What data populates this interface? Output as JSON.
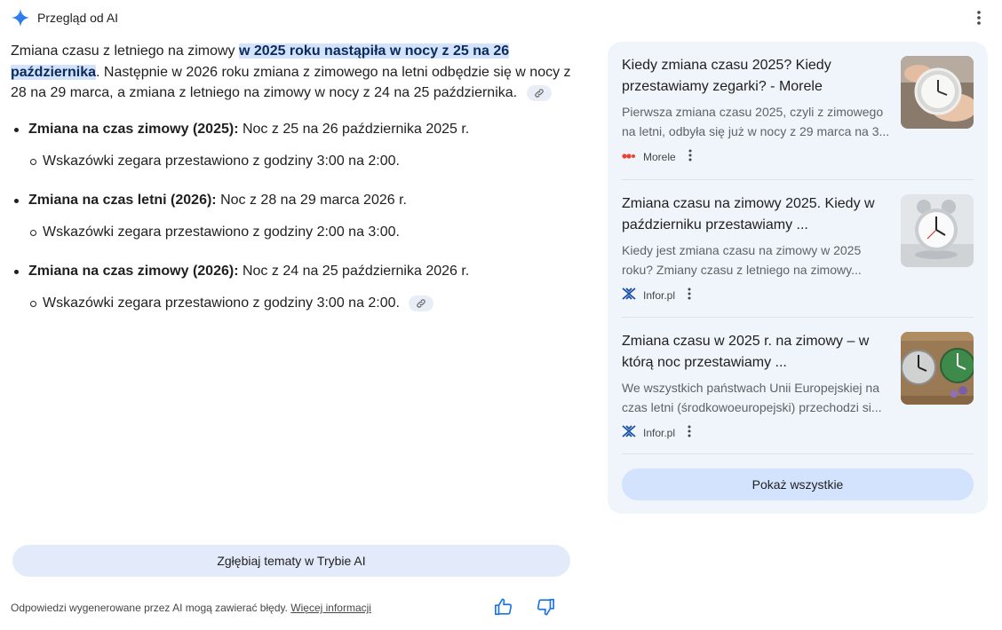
{
  "header": {
    "title": "Przegląd od AI",
    "icon": "sparkle-icon",
    "accent": "#4285f4"
  },
  "intro": {
    "before": "Zmiana czasu z letniego na zimowy ",
    "highlight": "w 2025 roku nastąpiła w nocy z 25 na 26 października",
    "after": ". Następnie w 2026 roku zmiana z zimowego na letni odbędzie się w nocy z 28 na 29 marca, a zmiana z letniego na zimowy w nocy z 24 na 25 października."
  },
  "bullets": [
    {
      "label": "Zmiana na czas zimowy (2025):",
      "text": " Noc z 25 na 26 października 2025 r.",
      "sub": "Wskazówki zegara przestawiono z godziny 3:00 na 2:00."
    },
    {
      "label": "Zmiana na czas letni (2026):",
      "text": " Noc z 28 na 29 marca 2026 r.",
      "sub": "Wskazówki zegara przestawiono z godziny 2:00 na 3:00."
    },
    {
      "label": "Zmiana na czas zimowy (2026):",
      "text": " Noc z 24 na 25 października 2026 r.",
      "sub": "Wskazówki zegara przestawiono z godziny 3:00 na 2:00."
    }
  ],
  "explore_button": "Zgłębiaj tematy w Trybie AI",
  "footer": {
    "text": "Odpowiedzi wygenerowane przez AI mogą zawierać błędy. ",
    "link": "Więcej informacji"
  },
  "sources": [
    {
      "title": "Kiedy zmiana czasu 2025? Kiedy przestawiamy zegarki? - Morele",
      "snippet_lines": [
        "Pierwsza zmiana czasu 2025, czyli z zimowego",
        "na letni, odbyła się już w nocy z 29 marca na 3..."
      ],
      "source": "Morele",
      "icon": "morele-logo-icon"
    },
    {
      "title": "Zmiana czasu na zimowy 2025. Kiedy w październiku przestawiamy ...",
      "snippet_lines": [
        "Kiedy jest zmiana czasu na zimowy w 2025",
        "roku? Zmiany czasu z letniego na zimowy..."
      ],
      "source": "Infor.pl",
      "icon": "infor-logo-icon"
    },
    {
      "title": "Zmiana czasu w 2025 r. na zimowy – w którą noc przestawiamy ...",
      "snippet_lines": [
        "We wszystkich państwach Unii Europejskiej na",
        "czas letni (środkowoeuropejski) przechodzi si..."
      ],
      "source": "Infor.pl",
      "icon": "infor-logo-icon"
    }
  ],
  "show_all": "Pokaż wszystkie",
  "colors": {
    "highlight_bg": "#d3e3fd",
    "panel_bg": "#f0f4fb",
    "button_bg": "#e3ebfb"
  }
}
